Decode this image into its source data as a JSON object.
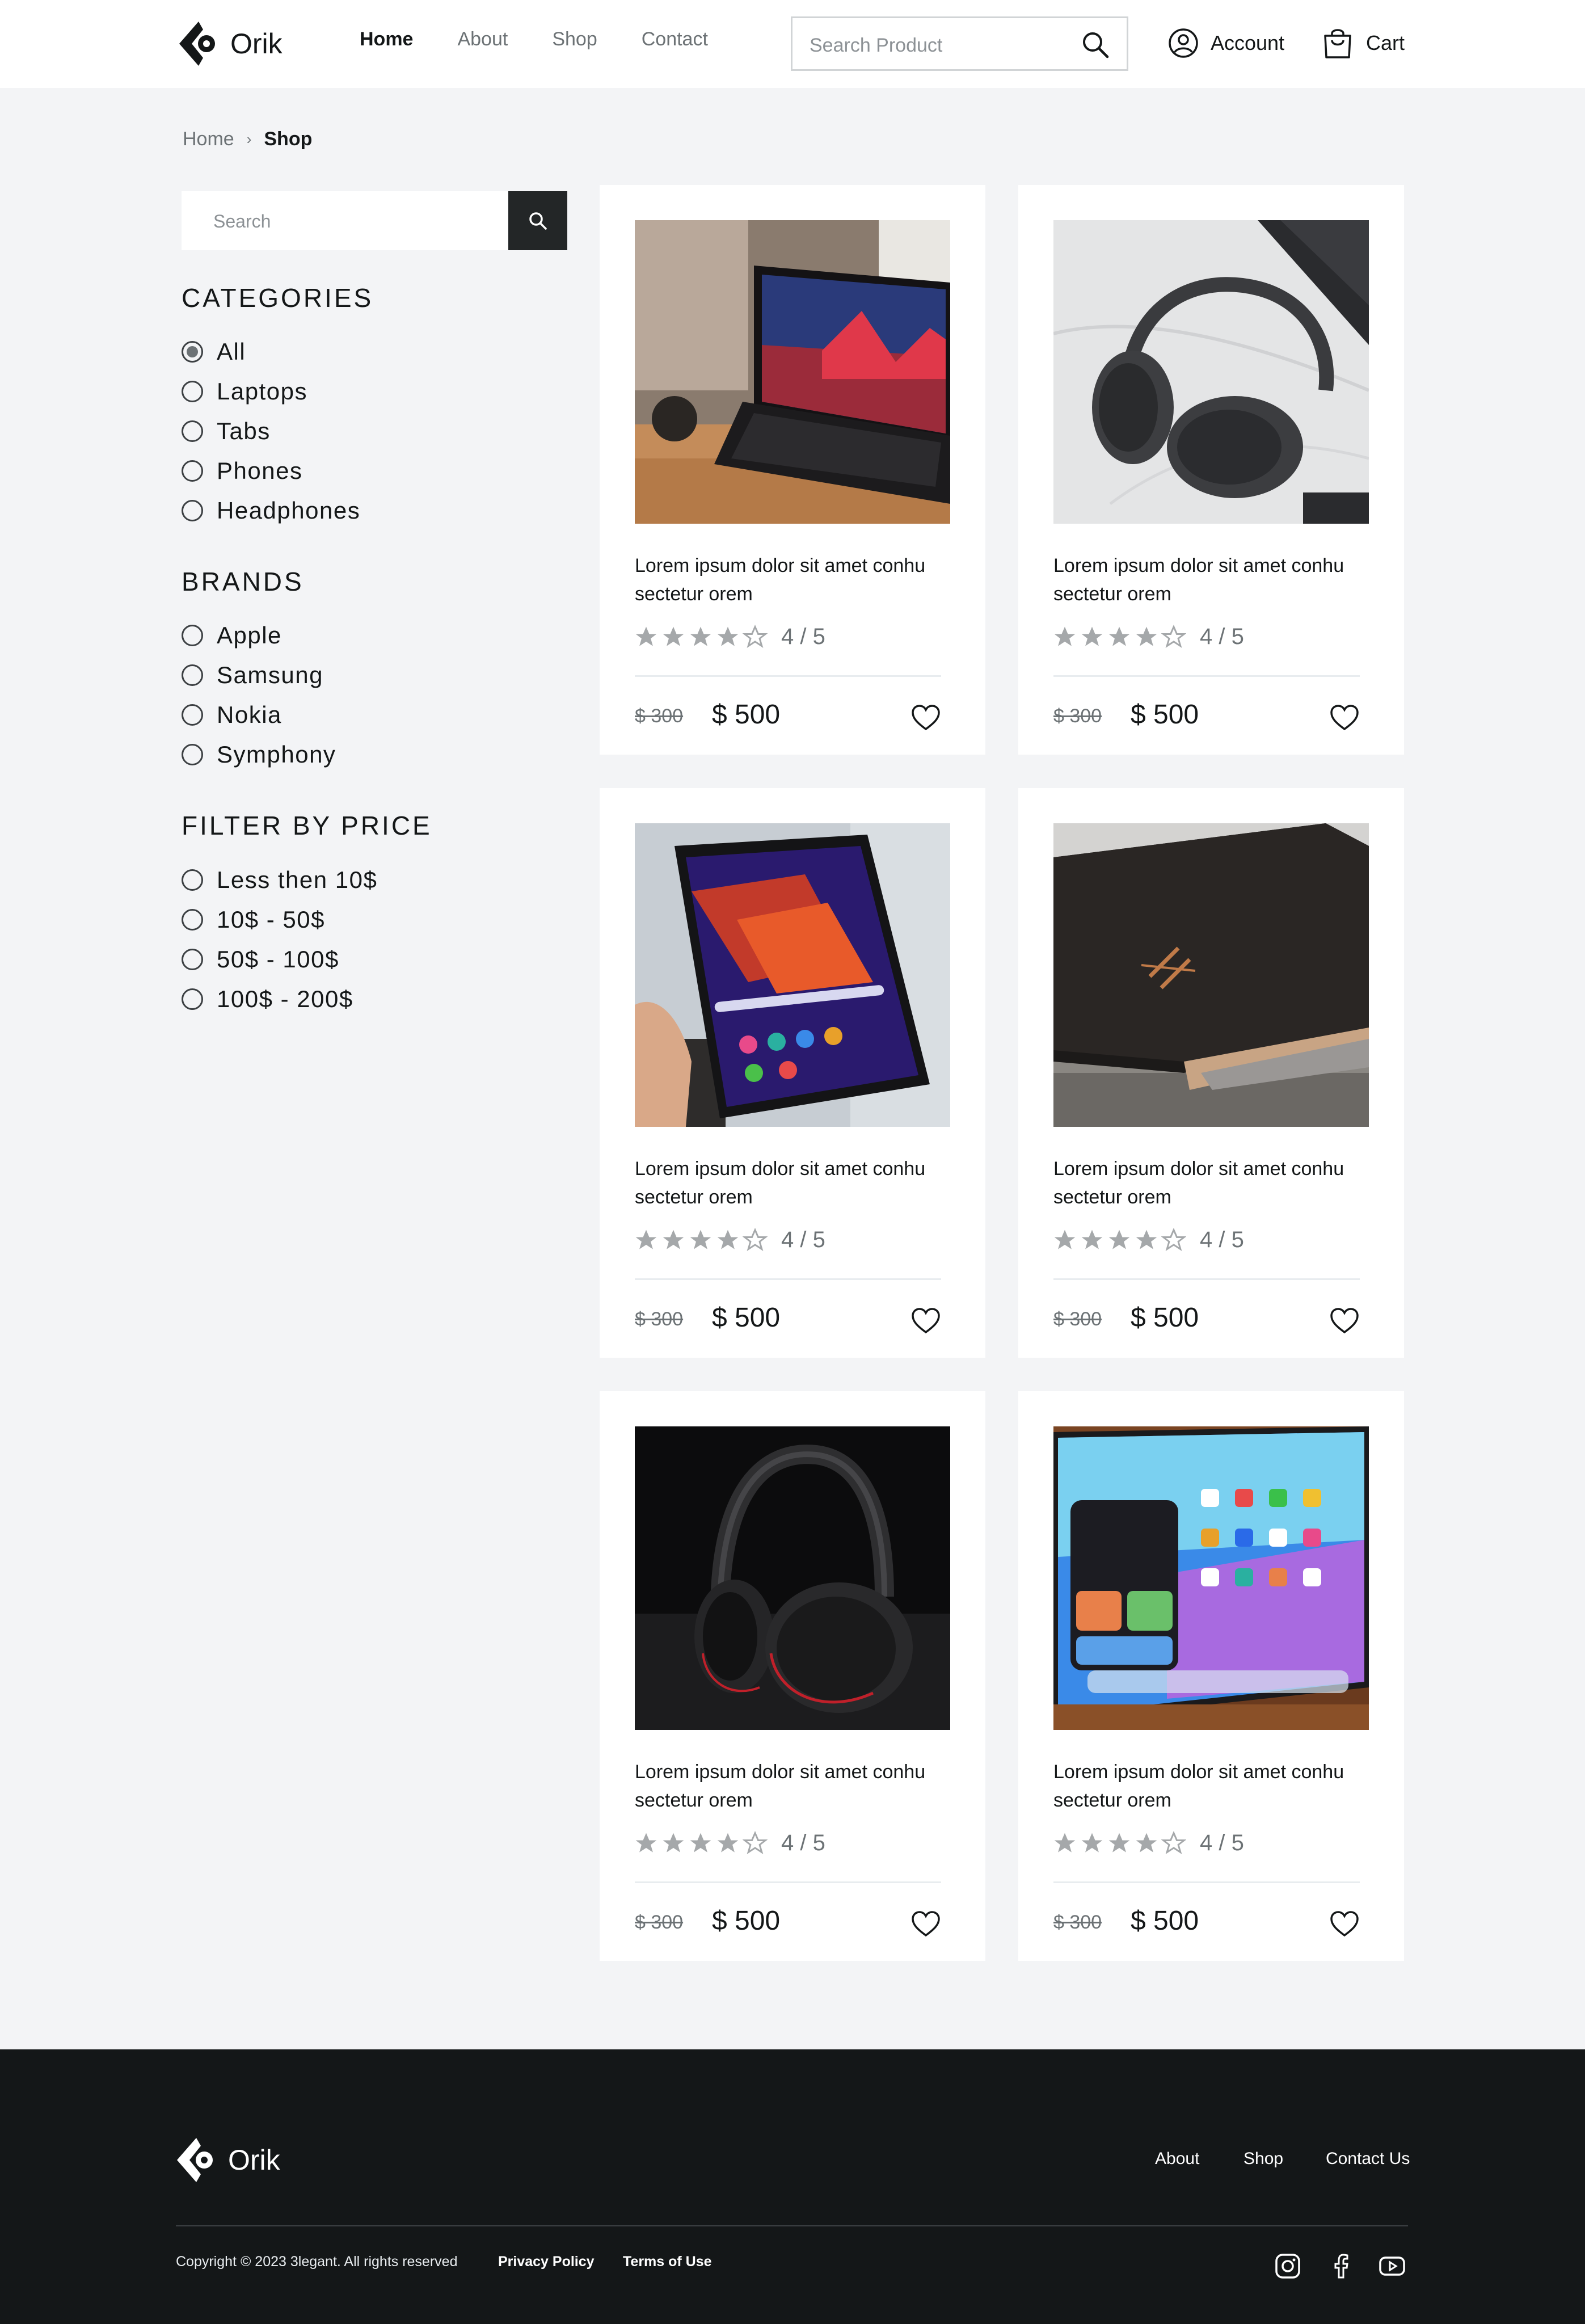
{
  "header": {
    "brand": "Orik",
    "nav": [
      {
        "label": "Home",
        "active": true
      },
      {
        "label": "About",
        "active": false
      },
      {
        "label": "Shop",
        "active": false
      },
      {
        "label": "Contact",
        "active": false
      }
    ],
    "search_placeholder": "Search Product",
    "account_label": "Account",
    "cart_label": "Cart"
  },
  "breadcrumb": {
    "home": "Home",
    "current": "Shop"
  },
  "sidebar": {
    "search_placeholder": "Search",
    "categories": {
      "title": "CATEGORIES",
      "options": [
        "All",
        "Laptops",
        "Tabs",
        "Phones",
        "Headphones"
      ],
      "selected": "All"
    },
    "brands": {
      "title": "BRANDS",
      "options": [
        "Apple",
        "Samsung",
        "Nokia",
        "Symphony"
      ]
    },
    "price": {
      "title": "FILTER BY PRICE",
      "options": [
        "Less then 10$",
        "10$ - 50$",
        "50$ - 100$",
        "100$ - 200$"
      ]
    }
  },
  "products": [
    {
      "title": "Lorem ipsum dolor sit amet conhu sectetur orem",
      "rating": 4,
      "rating_label": "4 / 5",
      "old_price": "$ 300",
      "price": "$ 500",
      "image": "laptop"
    },
    {
      "title": "Lorem ipsum dolor sit amet conhu sectetur orem",
      "rating": 4,
      "rating_label": "4 / 5",
      "old_price": "$ 300",
      "price": "$ 500",
      "image": "headphones-silver"
    },
    {
      "title": "Lorem ipsum dolor sit amet conhu sectetur orem",
      "rating": 4,
      "rating_label": "4 / 5",
      "old_price": "$ 300",
      "price": "$ 500",
      "image": "tablet-hand"
    },
    {
      "title": "Lorem ipsum dolor sit amet conhu sectetur orem",
      "rating": 4,
      "rating_label": "4 / 5",
      "old_price": "$ 300",
      "price": "$ 500",
      "image": "laptop-closed"
    },
    {
      "title": "Lorem ipsum dolor sit amet conhu sectetur orem",
      "rating": 4,
      "rating_label": "4 / 5",
      "old_price": "$ 300",
      "price": "$ 500",
      "image": "headphones-black"
    },
    {
      "title": "Lorem ipsum dolor sit amet conhu sectetur orem",
      "rating": 4,
      "rating_label": "4 / 5",
      "old_price": "$ 300",
      "price": "$ 500",
      "image": "ipad"
    }
  ],
  "footer": {
    "brand": "Orik",
    "nav": [
      "About",
      "Shop",
      "Contact Us"
    ],
    "copyright": "Copyright © 2023 3legant. All rights reserved",
    "privacy": "Privacy Policy",
    "terms": "Terms of Use",
    "social": [
      "instagram-icon",
      "facebook-icon",
      "youtube-icon"
    ]
  },
  "colors": {
    "background": "#f3f4f6",
    "text": "#141718",
    "muted": "#6c7275",
    "footer": "#141718",
    "star": "#a5a8aa"
  }
}
